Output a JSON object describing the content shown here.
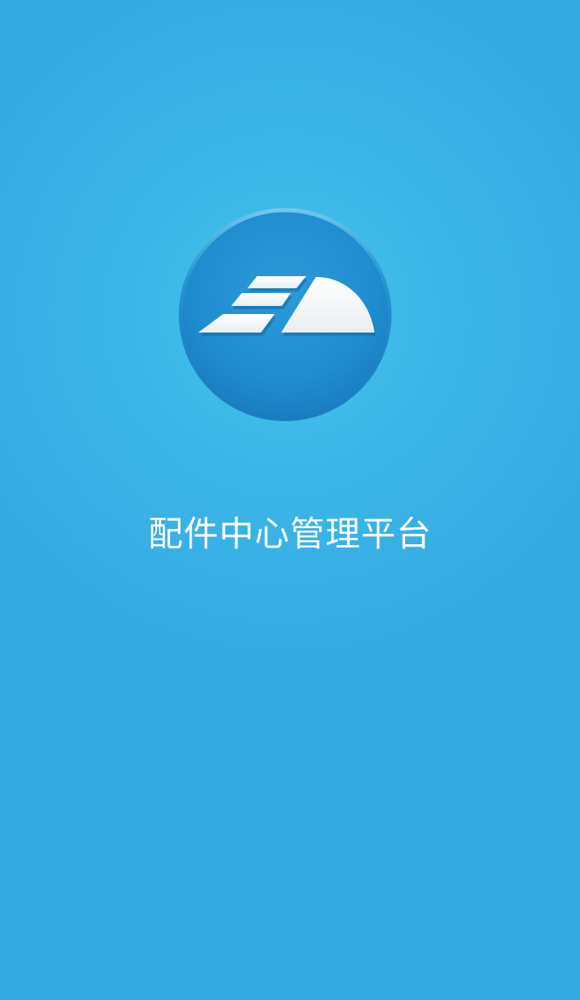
{
  "app": {
    "title": "配件中心管理平台",
    "logo_icon": "company-logo-icon"
  },
  "colors": {
    "background": "#35abe4",
    "logo_circle": "#1e86c9",
    "logo_glyph": "#ffffff",
    "title_text": "#ffffff"
  }
}
